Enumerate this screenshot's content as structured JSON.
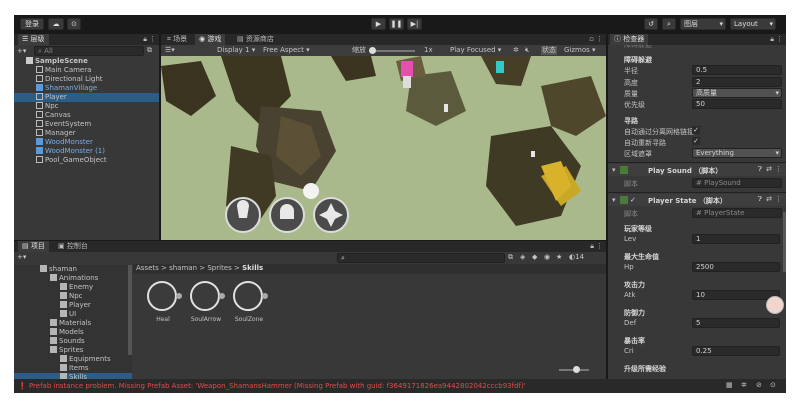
{
  "toolbar": {
    "login": "登录",
    "play_mode": "Play Focused",
    "layers": "图层",
    "layout": "Layout"
  },
  "hierarchy": {
    "tab": "层级",
    "search_placeholder": "All",
    "items": [
      {
        "label": "SampleScene",
        "type": "scene"
      },
      {
        "label": "Main Camera",
        "type": "object"
      },
      {
        "label": "Directional Light",
        "type": "object"
      },
      {
        "label": "ShamanVillage",
        "type": "prefab"
      },
      {
        "label": "Player",
        "type": "selected"
      },
      {
        "label": "Npc",
        "type": "object"
      },
      {
        "label": "Canvas",
        "type": "object"
      },
      {
        "label": "EventSystem",
        "type": "object"
      },
      {
        "label": "Manager",
        "type": "object"
      },
      {
        "label": "WoodMonster",
        "type": "prefab"
      },
      {
        "label": "WoodMonster (1)",
        "type": "prefab"
      },
      {
        "label": "Pool_GameObject",
        "type": "object"
      }
    ]
  },
  "game": {
    "tabs": [
      "场景",
      "游戏",
      "资源商店"
    ],
    "display": "Display 1",
    "aspect": "Free Aspect",
    "scale_label": "缩放",
    "scale_value": "1x",
    "stats": "状态",
    "gizmos": "Gizmos"
  },
  "project": {
    "tabs": [
      "项目",
      "控制台"
    ],
    "tree": [
      {
        "label": "shaman",
        "level": 0
      },
      {
        "label": "Animations",
        "level": 1
      },
      {
        "label": "Enemy",
        "level": 2
      },
      {
        "label": "Npc",
        "level": 2
      },
      {
        "label": "Player",
        "level": 2
      },
      {
        "label": "UI",
        "level": 2
      },
      {
        "label": "Materials",
        "level": 1
      },
      {
        "label": "Models",
        "level": 1
      },
      {
        "label": "Sounds",
        "level": 1
      },
      {
        "label": "Sprites",
        "level": 1
      },
      {
        "label": "Equipments",
        "level": 2
      },
      {
        "label": "Items",
        "level": 2
      },
      {
        "label": "Skills",
        "level": 2
      }
    ],
    "breadcrumb": [
      "Assets",
      "shaman",
      "Sprites",
      "Skills"
    ],
    "assets": [
      "Heal",
      "SoulArrow",
      "SoulZone"
    ],
    "count": "14"
  },
  "inspector": {
    "tab": "检查器",
    "nav_section": {
      "radius_label": "半径",
      "radius": "0.5",
      "height_label": "高度",
      "height": "2",
      "quality_label": "质量",
      "quality": "高质量",
      "priority_label": "优先级",
      "priority": "50",
      "pathfinding": "寻路",
      "auto_link": "自动通过分离网格链接",
      "auto_repath": "自动重新寻路",
      "area_mask_label": "区域遮罩",
      "area_mask": "Everything",
      "obstacle": "障碍躲避"
    },
    "play_sound": {
      "title": "Play Sound （脚本）",
      "script_label": "脚本",
      "script": "PlaySound"
    },
    "player_state": {
      "title": "Player State （脚本）",
      "script_label": "脚本",
      "script": "PlayerState",
      "fields": [
        {
          "header": "玩家等级",
          "name": "Lev",
          "value": "1"
        },
        {
          "header": "最大生命值",
          "name": "Hp",
          "value": "2500"
        },
        {
          "header": "攻击力",
          "name": "Atk",
          "value": "10"
        },
        {
          "header": "防御力",
          "name": "Def",
          "value": "5"
        },
        {
          "header": "暴击率",
          "name": "Cri",
          "value": "0.25"
        }
      ],
      "last_header": "升级所需经验"
    }
  },
  "status": {
    "error": "Prefab instance problem. Missing Prefab Asset: 'Weapon_ShamansHammer (Missing Prefab with guid: f3649171826ea9442802042cccb93fdf)'"
  },
  "colors": {
    "accent": "#2c5d87",
    "prefab": "#7aafe6",
    "error": "#e04c4c",
    "ground": "#a8b88a"
  }
}
